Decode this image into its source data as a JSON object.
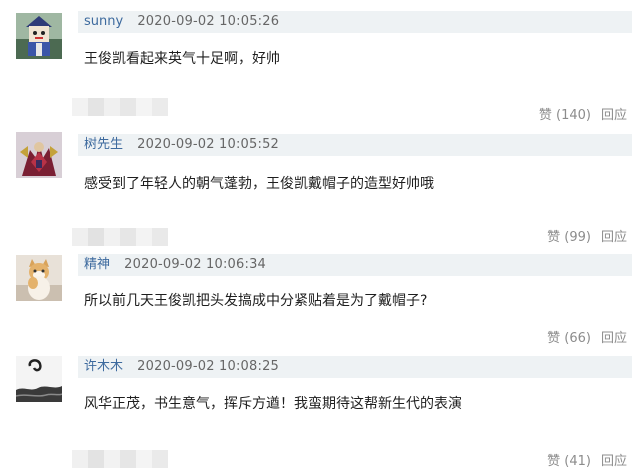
{
  "comments": [
    {
      "username": "sunny",
      "timestamp": "2020-09-02 10:05:26",
      "text": "王俊凯看起来英气十足啊，好帅",
      "like_label": "赞 (140)",
      "reply_label": "回应",
      "avatar": "avatar-cartoon-figure-icon"
    },
    {
      "username": "树先生",
      "timestamp": "2020-09-02 10:05:52",
      "text": "感受到了年轻人的朝气蓬勃，王俊凯戴帽子的造型好帅哦",
      "like_label": "赞 (99)",
      "reply_label": "回应",
      "avatar": "avatar-robot-figure-icon"
    },
    {
      "username": "精神",
      "timestamp": "2020-09-02 10:06:34",
      "text": "所以前几天王俊凯把头发搞成中分紧贴着是为了戴帽子?",
      "like_label": "赞 (66)",
      "reply_label": "回应",
      "avatar": "avatar-cat-icon"
    },
    {
      "username": "许木木",
      "timestamp": "2020-09-02 10:08:25",
      "text": "风华正茂，书生意气，挥斥方遒！我蛮期待这帮新生代的表演",
      "like_label": "赞 (41)",
      "reply_label": "回应",
      "avatar": "avatar-ink-landscape-icon"
    }
  ],
  "colors": {
    "meta_bar_bg": "#eef2f4",
    "username": "#3d6a9e",
    "timestamp": "#666666",
    "action_text": "#8c8c8c"
  }
}
